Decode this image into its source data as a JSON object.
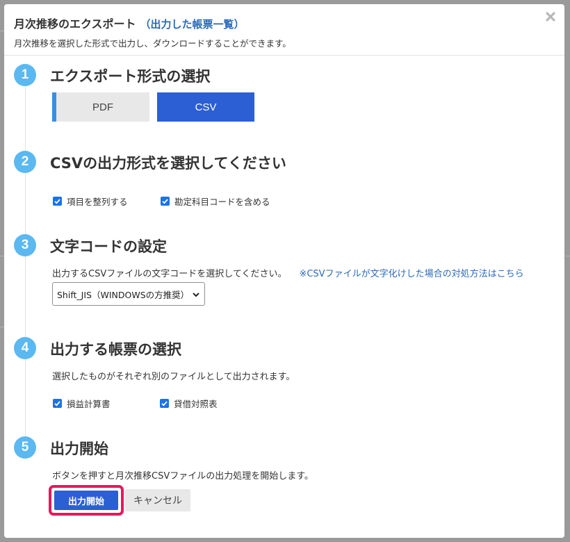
{
  "modal": {
    "title": "月次推移のエクスポート",
    "title_link": "（出力した帳票一覧）",
    "subtitle": "月次推移を選択した形式で出力し、ダウンロードすることができます。",
    "close_icon": "close-icon"
  },
  "steps": [
    {
      "number": "1",
      "title": "エクスポート形式の選択"
    },
    {
      "number": "2",
      "title": "CSVの出力形式を選択してください"
    },
    {
      "number": "3",
      "title": "文字コードの設定"
    },
    {
      "number": "4",
      "title": "出力する帳票の選択"
    },
    {
      "number": "5",
      "title": "出力開始"
    }
  ],
  "format": {
    "options": [
      "PDF",
      "CSV"
    ],
    "selected": "CSV"
  },
  "csv_options": [
    {
      "label": "項目を整列する",
      "checked": true
    },
    {
      "label": "勘定科目コードを含める",
      "checked": true
    }
  ],
  "encoding": {
    "description": "出力するCSVファイルの文字コードを選択してください。",
    "help_link": "※CSVファイルが文字化けした場合の対処方法はこちら",
    "selected": "Shift_JIS（WINDOWSの方推奨）"
  },
  "reports": {
    "description": "選択したものがそれぞれ別のファイルとして出力されます。",
    "items": [
      {
        "label": "損益計算書",
        "checked": true
      },
      {
        "label": "貸借対照表",
        "checked": true
      }
    ]
  },
  "start": {
    "description": "ボタンを押すと月次推移CSVファイルの出力処理を開始します。",
    "start_label": "出力開始",
    "cancel_label": "キャンセル"
  },
  "colors": {
    "accent": "#2c5fd3",
    "step_circle": "#5bb8f0",
    "highlight": "#e8175d",
    "link": "#2b6ab8"
  }
}
